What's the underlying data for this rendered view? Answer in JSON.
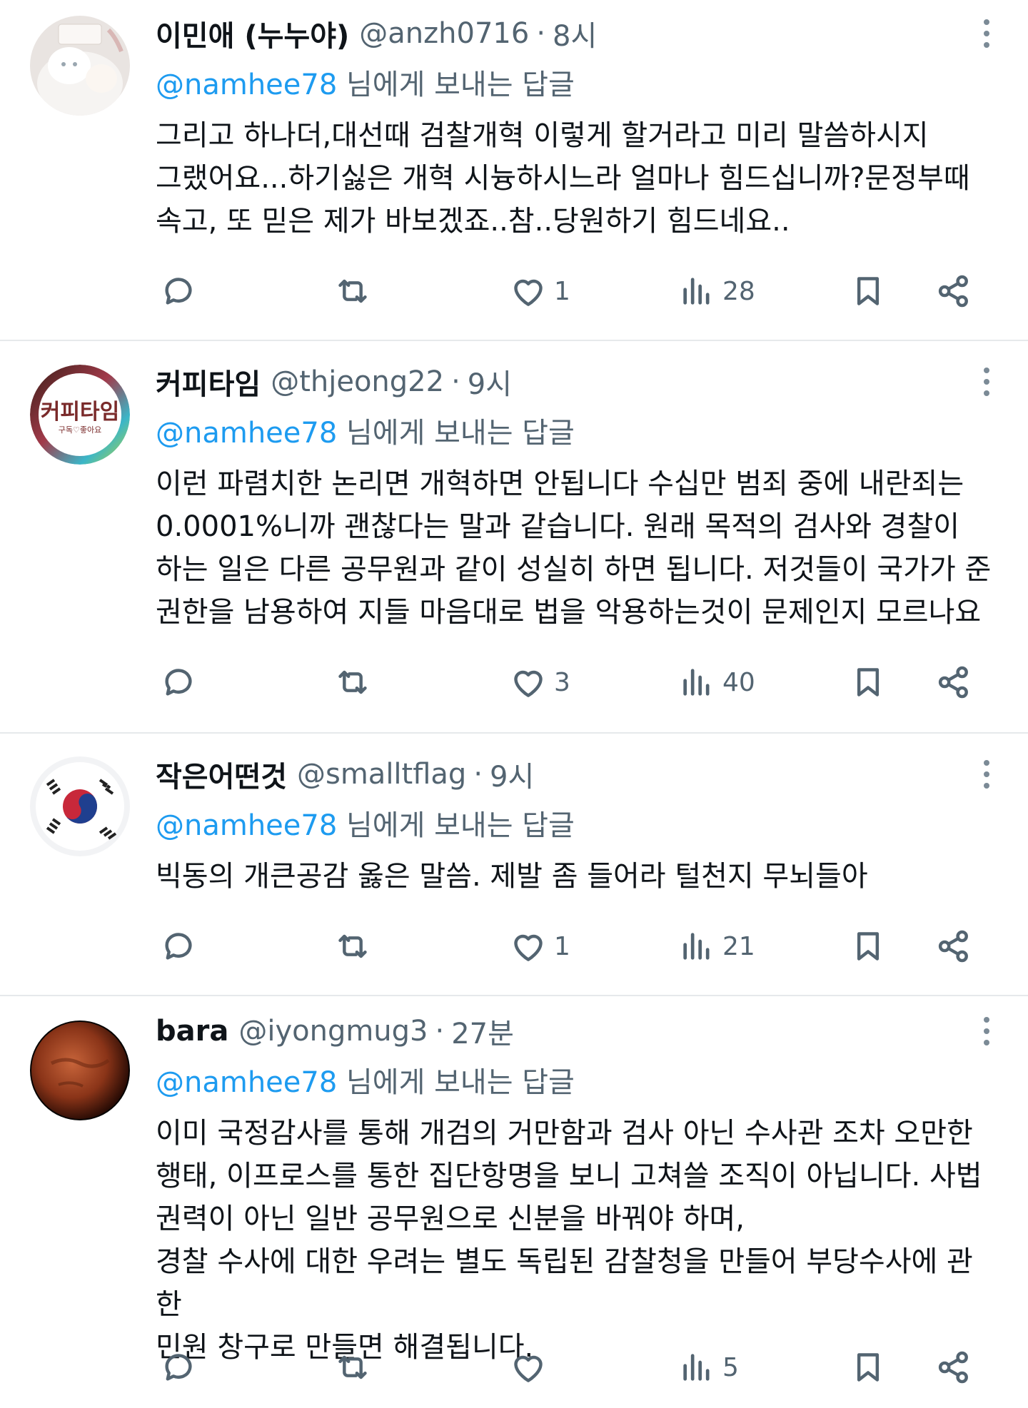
{
  "reply_to_prefix": "@namhee78",
  "reply_to_suffix": " 님에게 보내는 답글",
  "tweets": [
    {
      "name": "이민애 (누누야)",
      "handle": "@anzh0716",
      "dot": "·",
      "time": "8시",
      "text": "그리고 하나더,대선때 검찰개혁 이렇게 할거라고 미리 말씀하시지\n그랬어요...하기싫은 개혁 시늉하시느라 얼마나 힘드십니까?문정부때\n속고, 또 믿은 제가 바보겠죠..참..당원하기 힘드네요..",
      "likes": "1",
      "views": "28"
    },
    {
      "name": "커피타임",
      "handle": "@thjeong22",
      "dot": "·",
      "time": "9시",
      "text": "이런 파렴치한 논리면 개혁하면 안됩니다 수십만 범죄 중에 내란죄는\n0.0001%니까 괜찮다는 말과 같습니다. 원래 목적의 검사와 경찰이\n하는 일은 다른 공무원과 같이 성실히 하면 됩니다. 저것들이 국가가 준\n권한을 남용하여 지들 마음대로 법을 악용하는것이  문제인지 모르나요",
      "likes": "3",
      "views": "40",
      "avatar_text_top": "커피타임",
      "avatar_text_bottom": "구독♡좋아요"
    },
    {
      "name": "작은어떤것",
      "handle": "@smalltflag",
      "dot": "·",
      "time": "9시",
      "text": "빅동의 개큰공감 옳은 말씀. 제발 좀 들어라 털천지 무뇌들아",
      "likes": "1",
      "views": "21"
    },
    {
      "name": "bara",
      "handle": "@iyongmug3",
      "dot": "·",
      "time": "27분",
      "text": "이미 국정감사를 통해 개검의 거만함과 검사 아닌 수사관 조차 오만한\n행태, 이프로스를 통한 집단항명을 보니 고쳐쓸 조직이 아닙니다.  사법\n권력이 아닌 일반 공무원으로 신분을 바꿔야 하며,\n경찰 수사에 대한 우려는 별도 독립된 감찰청을 만들어 부당수사에 관한\n민원 창구로 만들면 해결됩니다.",
      "likes": "",
      "views": "5"
    }
  ],
  "colors": {
    "text": "#0f1419",
    "secondary": "#536471",
    "mention": "#1d9bf0",
    "divider": "#e6e9eb"
  },
  "icons": [
    "reply-icon",
    "retweet-icon",
    "like-icon",
    "views-icon",
    "bookmark-icon",
    "share-icon",
    "more-icon"
  ]
}
